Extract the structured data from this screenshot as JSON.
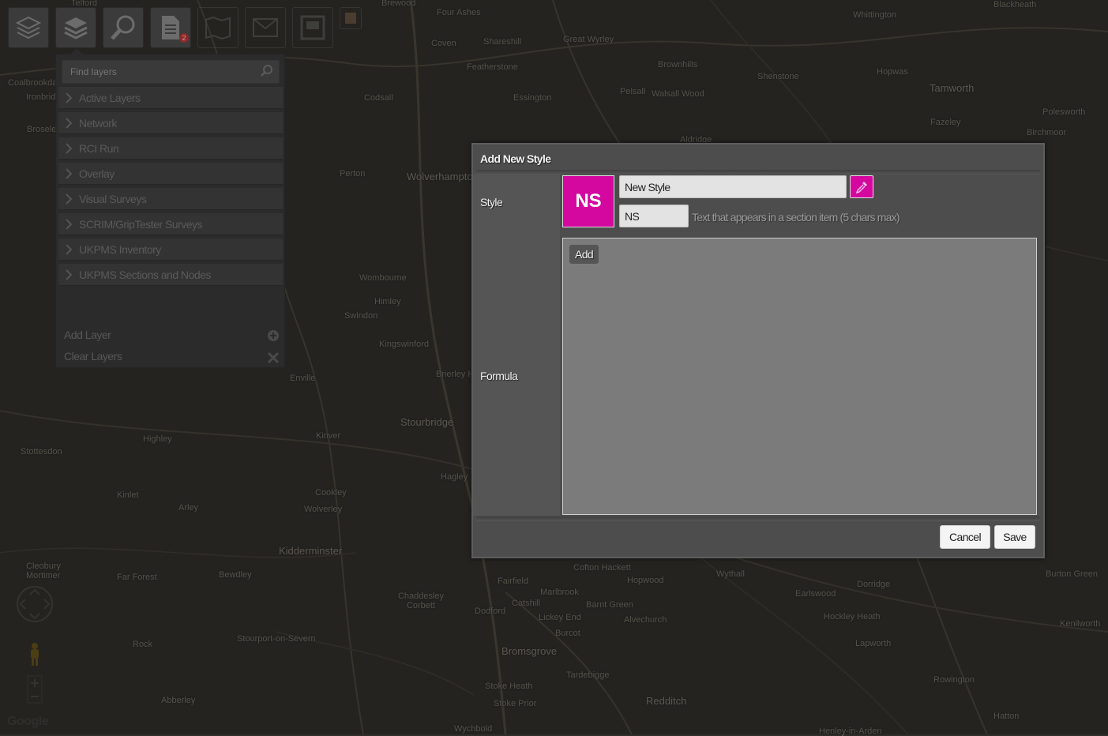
{
  "toolbar": {
    "buttons": [
      {
        "icon": "layers-icon"
      },
      {
        "icon": "active-layers-icon"
      },
      {
        "icon": "search-icon"
      },
      {
        "icon": "document-icon",
        "badge": "2"
      },
      {
        "icon": "map-icon"
      },
      {
        "icon": "mail-icon"
      },
      {
        "icon": "print-icon"
      },
      {
        "icon": "extra-icon"
      }
    ]
  },
  "layers_panel": {
    "search_placeholder": "Find layers",
    "items": [
      {
        "label": "Active Layers"
      },
      {
        "label": "Network"
      },
      {
        "label": "RCI Run"
      },
      {
        "label": "Overlay"
      },
      {
        "label": "Visual Surveys"
      },
      {
        "label": "SCRIM/GripTester Surveys"
      },
      {
        "label": "UKPMS Inventory"
      },
      {
        "label": "UKPMS Sections and Nodes"
      }
    ],
    "add_layer": "Add Layer",
    "clear_layers": "Clear Layers"
  },
  "map": {
    "attribution": "Google",
    "labels": [
      "Telford",
      "Brewood",
      "Four Ashes",
      "Whittington",
      "Coven",
      "Shareshill",
      "Great Wyrley",
      "Brownhills",
      "Shenstone",
      "Hopwas",
      "Tamworth",
      "Coalbrookdale",
      "Ironbridge",
      "Featherstone",
      "Essington",
      "Codsall",
      "Pelsall",
      "Walsall Wood",
      "Aldridge",
      "Fazeley",
      "Polesworth",
      "Birchmoor",
      "Broseley",
      "Perton",
      "Wolverhampton",
      "Wombourne",
      "Himley",
      "Swindon",
      "Kingswinford",
      "Brierley Hill",
      "Enville",
      "Stourbridge",
      "Kinver",
      "Highley",
      "Stottesdon",
      "Hagley",
      "Cookley",
      "Kinlet",
      "Arley",
      "Wolverley",
      "Kidderminster",
      "Cleobury Mortimer",
      "Far Forest",
      "Bewdley",
      "Chaddesley Corbett",
      "Fairfield",
      "Alvechurch",
      "Barnt Green",
      "Hopwood",
      "Wythall",
      "Earlswood",
      "Dorridge",
      "Hockley Heath",
      "Lapworth",
      "Kenilworth",
      "Burton Green",
      "Rock",
      "Stourport-on-Severn",
      "Dodford",
      "Catshill",
      "Lickey End",
      "Burcot",
      "Bromsgrove",
      "Tardebigge",
      "Stoke Heath",
      "Stoke Prior",
      "Redditch",
      "Rowington",
      "Hatton",
      "Abberley",
      "Wychbold",
      "Cofton Hackett",
      "Marlbrook",
      "Blackheath",
      "Henley-in-Arden"
    ]
  },
  "modal": {
    "title": "Add New Style",
    "style_label": "Style",
    "formula_label": "Formula",
    "preview_text": "NS",
    "name_value": "New Style",
    "short_value": "NS",
    "short_hint": "Text that appears in a section item (5 chars max)",
    "add_label": "Add",
    "cancel_label": "Cancel",
    "save_label": "Save",
    "color_picker_icon": "eyedropper-icon",
    "style_color": "#d4089f"
  }
}
